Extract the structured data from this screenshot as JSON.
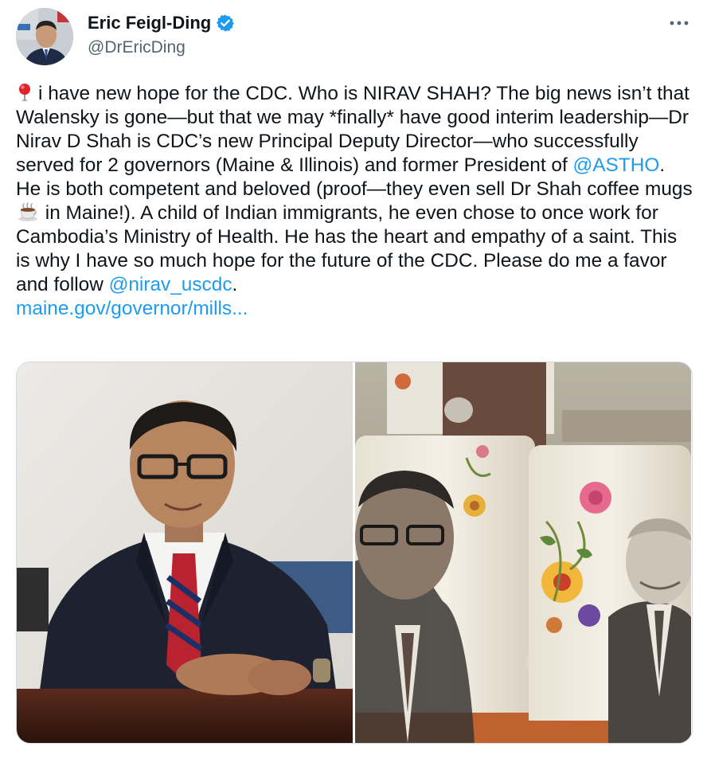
{
  "author": {
    "display_name": "Eric Feigl-Ding",
    "handle": "@DrEricDing",
    "verified": true,
    "avatar_icon": "profile-photo"
  },
  "tweet": {
    "emoji_pin": "round-pushpin",
    "text_1": "i have new hope for the CDC. Who is NIRAV SHAH? The big news isn’t that Walensky is gone—but that we may *finally* have good interim leadership—Dr Nirav D Shah is CDC’s new Principal Deputy Director—who successfully served for 2 governors (Maine & Illinois) and former President of ",
    "mention_1": "@ASTHO",
    "text_2": ". He is both competent and beloved (proof—they even sell Dr Shah coffee mugs ",
    "emoji_coffee": "hot-beverage",
    "text_3": " in Maine!). A child of Indian immigrants, he even chose to once work for Cambodia’s Ministry of Health. He has the heart and empathy of a saint. This is why I have so much hope for the future of the CDC. Please do me a favor and follow ",
    "mention_2": "@nirav_uscdc",
    "text_4": ".",
    "link": "maine.gov/governor/mills..."
  },
  "media": {
    "photos": [
      {
        "icon": "portrait-man-in-suit-photo"
      },
      {
        "icon": "coffee-mugs-photo"
      }
    ]
  },
  "colors": {
    "accent": "#1d9bf0",
    "text": "#0f1419",
    "secondary": "#536471",
    "border": "#cfd9de"
  }
}
